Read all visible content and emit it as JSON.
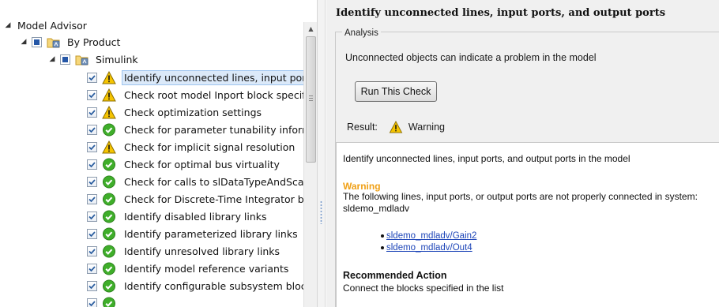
{
  "tree": {
    "root_label": "Model Advisor",
    "by_product_label": "By Product",
    "simulink_label": "Simulink",
    "checks": [
      {
        "label": "Identify unconnected lines, input ports, and output ports",
        "status": "warning",
        "selected": true
      },
      {
        "label": "Check root model Inport block specifications",
        "status": "warning"
      },
      {
        "label": "Check optimization settings",
        "status": "warning"
      },
      {
        "label": "Check for parameter tunability information ignored for referenced models",
        "status": "passed"
      },
      {
        "label": "Check for implicit signal resolution",
        "status": "warning"
      },
      {
        "label": "Check for optimal bus virtuality",
        "status": "passed"
      },
      {
        "label": "Check for calls to slDataTypeAndScale",
        "status": "passed"
      },
      {
        "label": "Check for Discrete-Time Integrator blocks with initial condition uncertainty",
        "status": "passed"
      },
      {
        "label": "Identify disabled library links",
        "status": "passed"
      },
      {
        "label": "Identify parameterized library links",
        "status": "passed"
      },
      {
        "label": "Identify unresolved library links",
        "status": "passed"
      },
      {
        "label": "Identify model reference variants",
        "status": "passed"
      },
      {
        "label": "Identify configurable subsystem blocks",
        "status": "passed"
      }
    ]
  },
  "details": {
    "title": "Identify unconnected lines, input ports, and output ports",
    "analysis_label": "Analysis",
    "description": "Unconnected objects can indicate a problem in the model",
    "run_button_label": "Run This Check",
    "result_label": "Result:",
    "result_value": "Warning",
    "report": {
      "description": "Identify unconnected lines, input ports, and output ports in the model",
      "warning_heading": "Warning",
      "warning_text": "The following lines, input ports, or output ports are not properly connected in system: sldemo_mdladv",
      "links": [
        "sldemo_mdladv/Gain2",
        "sldemo_mdladv/Out4"
      ],
      "recommended_heading": "Recommended Action",
      "recommended_text": "Connect the blocks specified in the list"
    }
  },
  "icons": {
    "warning": "warning-triangle-icon",
    "passed": "green-check-circle-icon",
    "folder": "folder-icon",
    "checkbox": "checkbox-checked-icon"
  },
  "colors": {
    "warning_yellow": "#f5c400",
    "passed_green": "#3fae2a",
    "warning_text_orange": "#f0a016",
    "link_blue": "#1d45b8",
    "selected_highlight": "#dbe9f9"
  }
}
